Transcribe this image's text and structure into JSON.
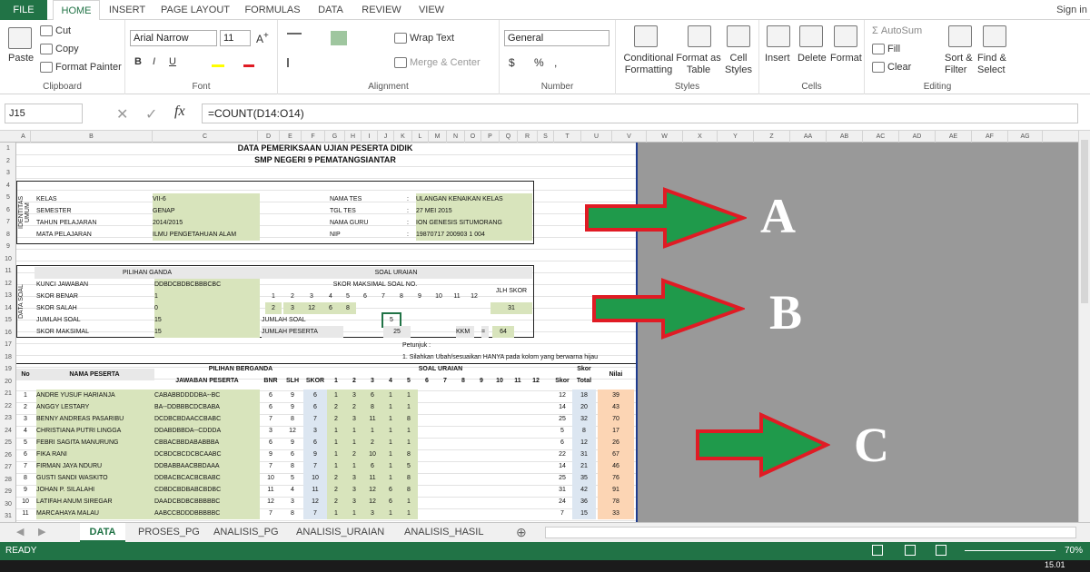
{
  "ribbon_tabs": [
    "FILE",
    "HOME",
    "INSERT",
    "PAGE LAYOUT",
    "FORMULAS",
    "DATA",
    "REVIEW",
    "VIEW"
  ],
  "sign_in": "Sign in",
  "clipboard": {
    "paste": "Paste",
    "cut": "Cut",
    "copy": "Copy",
    "format_painter": "Format Painter",
    "label": "Clipboard"
  },
  "font": {
    "name": "Arial Narrow",
    "size": "11",
    "label": "Font"
  },
  "alignment": {
    "wrap": "Wrap Text",
    "merge": "Merge & Center",
    "label": "Alignment"
  },
  "number": {
    "format": "General",
    "label": "Number"
  },
  "styles": {
    "cond": "Conditional Formatting",
    "table": "Format as Table",
    "cell": "Cell Styles",
    "label": "Styles"
  },
  "cells": {
    "insert": "Insert",
    "delete": "Delete",
    "format": "Format",
    "label": "Cells"
  },
  "editing": {
    "autosum": "AutoSum",
    "fill": "Fill",
    "clear": "Clear",
    "sort": "Sort & Filter",
    "find": "Find & Select",
    "label": "Editing"
  },
  "name_box": "J15",
  "formula": "=COUNT(D14:O14)",
  "columns": [
    "A",
    "B",
    "C",
    "D",
    "E",
    "F",
    "G",
    "H",
    "I",
    "J",
    "K",
    "L",
    "M",
    "N",
    "O",
    "P",
    "Q",
    "R",
    "S",
    "T",
    "U",
    "V",
    "W",
    "X",
    "Y",
    "Z",
    "AA",
    "AB",
    "AC",
    "AD",
    "AE",
    "AF",
    "AG"
  ],
  "rows": [
    "1",
    "2",
    "3",
    "4",
    "5",
    "6",
    "7",
    "8",
    "9",
    "10",
    "11",
    "12",
    "13",
    "14",
    "15",
    "16",
    "17",
    "18",
    "19",
    "20",
    "21",
    "22",
    "23",
    "24",
    "25",
    "26",
    "27",
    "28",
    "29",
    "30",
    "31"
  ],
  "title1": "DATA PEMERIKSAAN UJIAN PESERTA DIDIK",
  "title2": "SMP NEGERI 9 PEMATANGSIANTAR",
  "identitas": "IDENTITAS UMUM",
  "info_left": [
    [
      "KELAS",
      "VII-6"
    ],
    [
      "SEMESTER",
      "GENAP"
    ],
    [
      "TAHUN PELAJARAN",
      "2014/2015"
    ],
    [
      "MATA PELAJARAN",
      "ILMU PENGETAHUAN ALAM"
    ]
  ],
  "info_right": [
    [
      "NAMA TES",
      ":",
      "ULANGAN KENAIKAN KELAS"
    ],
    [
      "TGL TES",
      ":",
      "27 MEI 2015"
    ],
    [
      "NAMA GURU",
      ":",
      "ION GENESIS SITUMORANG"
    ],
    [
      "NIP",
      ":",
      "19870717 200903 1 004"
    ]
  ],
  "data_soal": "DATA SOAL",
  "pg_header": "PILIHAN GANDA",
  "pg_rows": [
    [
      "KUNCI JAWABAN",
      "DDBDCBDBCBBBCBC"
    ],
    [
      "SKOR BENAR",
      "1"
    ],
    [
      "SKOR SALAH",
      "0"
    ],
    [
      "JUMLAH SOAL",
      "15"
    ],
    [
      "SKOR MAKSIMAL",
      "15"
    ]
  ],
  "uraian_header": "SOAL URAIAN",
  "skor_max_label": "SKOR MAKSIMAL SOAL NO.",
  "jlh_skor": "JLH SKOR",
  "nums": [
    "1",
    "2",
    "3",
    "4",
    "5",
    "6",
    "7",
    "8",
    "9",
    "10",
    "11",
    "12"
  ],
  "skor_max": [
    "2",
    "3",
    "12",
    "6",
    "8"
  ],
  "jlh_val": "31",
  "jumlah_soal": "JUMLAH SOAL",
  "jumlah_soal_val": "5",
  "jumlah_peserta": "JUMLAH PESERTA",
  "jumlah_peserta_val": "25",
  "kkm": "KKM",
  "kkm_eq": "=",
  "kkm_val": "64",
  "petunjuk": "Petunjuk :",
  "petunjuk1": "1. Silahkan Ubah/sesuaikan HANYA pada kolom yang berwarna hijau",
  "tbl": {
    "no": "No",
    "nama": "NAMA PESERTA",
    "pilihan": "PILIHAN BERGANDA",
    "jawaban": "JAWABAN PESERTA",
    "bnr": "BNR",
    "slh": "SLH",
    "skor": "SKOR",
    "uraian": "SOAL URAIAN",
    "skor_u": "Skor",
    "skor_total": "Skor Total",
    "nilai": "Nilai"
  },
  "students": [
    [
      "1",
      "ANDRE YUSUF HARIANJA",
      "CABABBDDDDBA--BC",
      "6",
      "9",
      "6",
      "1",
      "3",
      "6",
      "1",
      "1",
      "12",
      "18",
      "39"
    ],
    [
      "2",
      "ANGGY LESTARY",
      "BA--DDBBBCDCBABA",
      "6",
      "9",
      "6",
      "2",
      "2",
      "8",
      "1",
      "1",
      "14",
      "20",
      "43"
    ],
    [
      "3",
      "BENNY ANDREAS PASARIBU",
      "DCDBCBDAACCBABC",
      "7",
      "8",
      "7",
      "2",
      "3",
      "11",
      "1",
      "8",
      "25",
      "32",
      "70"
    ],
    [
      "4",
      "CHRISTIANA PUTRI LINGGA",
      "DDABDBBDA--CDDDA",
      "3",
      "12",
      "3",
      "1",
      "1",
      "1",
      "1",
      "1",
      "5",
      "8",
      "17"
    ],
    [
      "5",
      "FEBRI SAGITA MANURUNG",
      "CBBACBBDABABBBA",
      "6",
      "9",
      "6",
      "1",
      "1",
      "2",
      "1",
      "1",
      "6",
      "12",
      "26"
    ],
    [
      "6",
      "FIKA RANI",
      "DCBDCBCDCBCAABC",
      "9",
      "6",
      "9",
      "1",
      "2",
      "10",
      "1",
      "8",
      "22",
      "31",
      "67"
    ],
    [
      "7",
      "FIRMAN JAYA NDURU",
      "DDBABBAACBBDAAA",
      "7",
      "8",
      "7",
      "1",
      "1",
      "6",
      "1",
      "5",
      "14",
      "21",
      "46"
    ],
    [
      "8",
      "GUSTI SANDI WASKITO",
      "DDBACBCACBCBABC",
      "10",
      "5",
      "10",
      "2",
      "3",
      "11",
      "1",
      "8",
      "25",
      "35",
      "76"
    ],
    [
      "9",
      "JOHAN P. SILALAHI",
      "CDBDCBDBABCBDBC",
      "11",
      "4",
      "11",
      "2",
      "3",
      "12",
      "6",
      "8",
      "31",
      "42",
      "91"
    ],
    [
      "10",
      "LATIFAH ANUM SIREGAR",
      "DAADCBDBCBBBBBC",
      "12",
      "3",
      "12",
      "2",
      "3",
      "12",
      "6",
      "1",
      "24",
      "36",
      "78"
    ],
    [
      "11",
      "MARCAHAYA MALAU",
      "AABCCBDDDBBBBBC",
      "7",
      "8",
      "7",
      "1",
      "1",
      "3",
      "1",
      "1",
      "7",
      "15",
      "33"
    ]
  ],
  "arrow_labels": [
    "A",
    "B",
    "C"
  ],
  "sheet_tabs": [
    "DATA",
    "PROSES_PG",
    "ANALISIS_PG",
    "ANALISIS_URAIAN",
    "ANALISIS_HASIL"
  ],
  "status": "READY",
  "zoom": "70%",
  "clock": "15.01",
  "colors": {
    "excel_green": "#217346",
    "cell_green": "#d8e4bc",
    "arrow_green": "#1f9a4b",
    "arrow_red": "#e01b24",
    "grey": "#999999"
  }
}
